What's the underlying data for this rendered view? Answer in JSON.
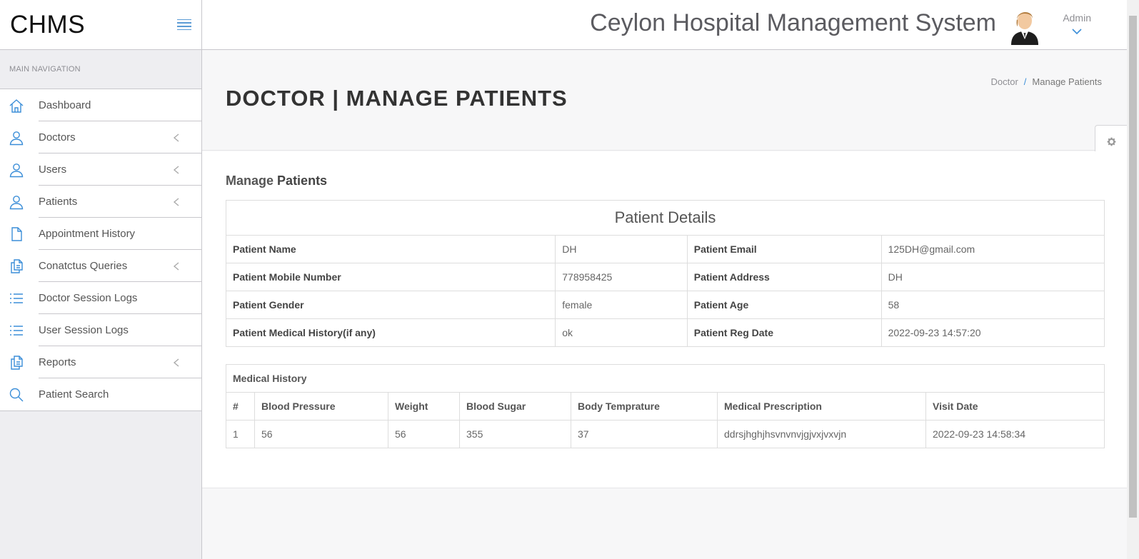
{
  "brand": {
    "name": "CHMS"
  },
  "nav": {
    "heading": "MAIN NAVIGATION",
    "items": [
      {
        "label": "Dashboard",
        "icon": "home-icon",
        "submenu": false
      },
      {
        "label": "Doctors",
        "icon": "user-icon",
        "submenu": true
      },
      {
        "label": "Users",
        "icon": "user-icon",
        "submenu": true
      },
      {
        "label": "Patients",
        "icon": "user-icon",
        "submenu": true
      },
      {
        "label": "Appointment History",
        "icon": "file-icon",
        "submenu": false
      },
      {
        "label": "Conatctus Queries",
        "icon": "files-icon",
        "submenu": true
      },
      {
        "label": "Doctor Session Logs",
        "icon": "list-icon",
        "submenu": false
      },
      {
        "label": "User Session Logs",
        "icon": "list-icon",
        "submenu": false
      },
      {
        "label": "Reports",
        "icon": "files-icon",
        "submenu": true
      },
      {
        "label": "Patient Search",
        "icon": "search-icon",
        "submenu": false
      }
    ]
  },
  "header": {
    "title": "Ceylon Hospital Management System",
    "user": "Admin"
  },
  "page": {
    "title": "DOCTOR | MANAGE PATIENTS",
    "breadcrumb": {
      "parent": "Doctor",
      "separator": "/",
      "current": "Manage Patients"
    }
  },
  "section": {
    "title_light": "Manage",
    "title_bold": "Patients"
  },
  "details": {
    "caption": "Patient Details",
    "rows": [
      [
        "Patient Name",
        "DH",
        "Patient Email",
        "125DH@gmail.com"
      ],
      [
        "Patient Mobile Number",
        "778958425",
        "Patient Address",
        "DH"
      ],
      [
        "Patient Gender",
        "female",
        "Patient Age",
        "58"
      ],
      [
        "Patient Medical History(if any)",
        "ok",
        "Patient Reg Date",
        "2022-09-23 14:57:20"
      ]
    ]
  },
  "history": {
    "caption": "Medical History",
    "headers": [
      "#",
      "Blood Pressure",
      "Weight",
      "Blood Sugar",
      "Body Temprature",
      "Medical Prescription",
      "Visit Date"
    ],
    "rows": [
      [
        "1",
        "56",
        "56",
        "355",
        "37",
        "ddrsjhghjhsvnvnvjgjvxjvxvjn",
        "2022-09-23 14:58:34"
      ]
    ]
  },
  "colors": {
    "accent": "#3b8ed8",
    "sidebar_bg": "#eeeef1",
    "border": "#c8c7cc"
  }
}
